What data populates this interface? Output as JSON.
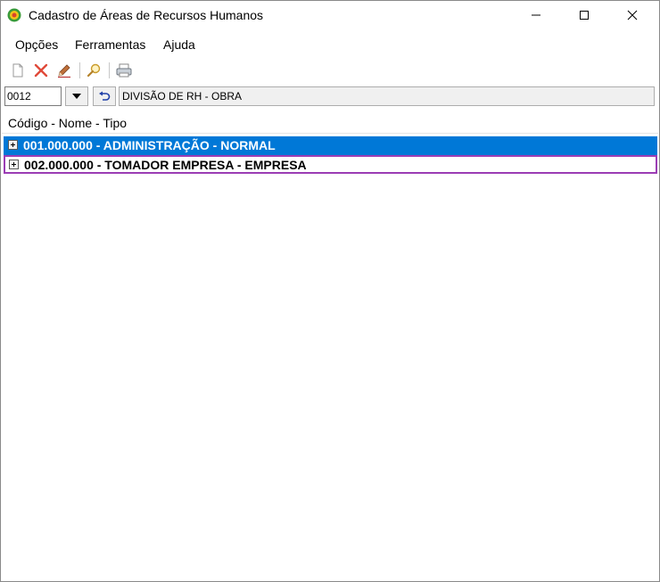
{
  "window": {
    "title": "Cadastro de Áreas de Recursos Humanos"
  },
  "menu": {
    "items": [
      "Opções",
      "Ferramentas",
      "Ajuda"
    ]
  },
  "toolbar": {
    "icons": [
      "new-document-icon",
      "delete-icon",
      "edit-icon",
      "search-icon",
      "print-icon"
    ]
  },
  "selector": {
    "code_value": "0012",
    "description": "DIVISÃO DE RH - OBRA"
  },
  "list": {
    "header": "Código - Nome - Tipo",
    "rows": [
      {
        "label": "001.000.000 - ADMINISTRAÇÃO - NORMAL",
        "selected": true
      },
      {
        "label": "002.000.000 - TOMADOR EMPRESA - EMPRESA",
        "selected": false
      }
    ]
  },
  "colors": {
    "selection": "#0078d7",
    "focus_outline": "#9b3db4"
  }
}
